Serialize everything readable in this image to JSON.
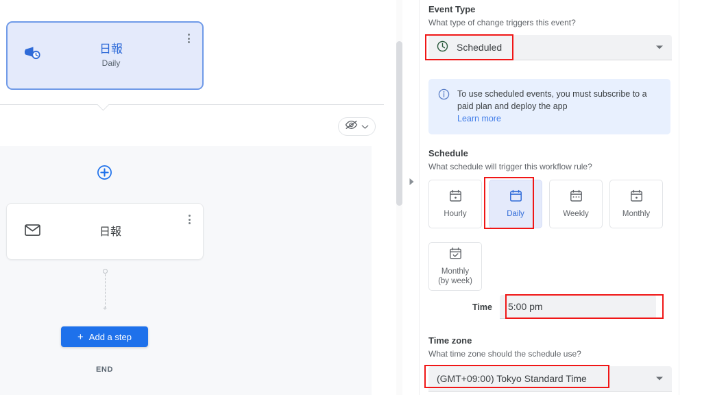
{
  "canvas": {
    "trigger_card": {
      "icon": "megaphone-clock-icon",
      "title": "日報",
      "subtitle": "Daily",
      "menu_icon": "kebab-menu-icon"
    },
    "visibility_toggle": {
      "icon": "eye-off-icon",
      "chevron": "chevron-down-icon"
    },
    "add_branch_icon": "plus-circle-icon",
    "action_card": {
      "icon": "envelope-icon",
      "title": "日報",
      "menu_icon": "kebab-menu-icon"
    },
    "add_step_button": {
      "label": "Add a step",
      "plus": "+"
    },
    "end_label": "END"
  },
  "splitter": {
    "toggle_icon": "panel-expand-arrow-icon"
  },
  "panel": {
    "event_type": {
      "label": "Event Type",
      "help": "What type of change triggers this event?",
      "selected": "Scheduled",
      "icon": "clock-icon"
    },
    "info": {
      "icon": "info-circle-icon",
      "text": "To use scheduled events, you must subscribe to a paid plan and deploy the app",
      "link": "Learn more"
    },
    "schedule": {
      "label": "Schedule",
      "help": "What schedule will trigger this workflow rule?",
      "options": [
        {
          "label": "Hourly",
          "icon": "calendar-dot-icon",
          "selected": false
        },
        {
          "label": "Daily",
          "icon": "calendar-icon",
          "selected": true
        },
        {
          "label": "Weekly",
          "icon": "calendar-week-icon",
          "selected": false
        },
        {
          "label": "Monthly",
          "icon": "calendar-dot-icon",
          "selected": false
        },
        {
          "label": "Monthly\n(by week)",
          "icon": "calendar-check-icon",
          "selected": false
        }
      ]
    },
    "time": {
      "label": "Time",
      "value": "5:00 pm"
    },
    "timezone": {
      "label": "Time zone",
      "help": "What time zone should the schedule use?",
      "selected": "(GMT+09:00) Tokyo Standard Time"
    }
  },
  "colors": {
    "accent_blue": "#1E71EB",
    "selected_fill": "#E4EAFB",
    "annotation_red": "#F01616",
    "info_bg": "#E8F0FE",
    "clock_green": "#2A5A3C"
  }
}
